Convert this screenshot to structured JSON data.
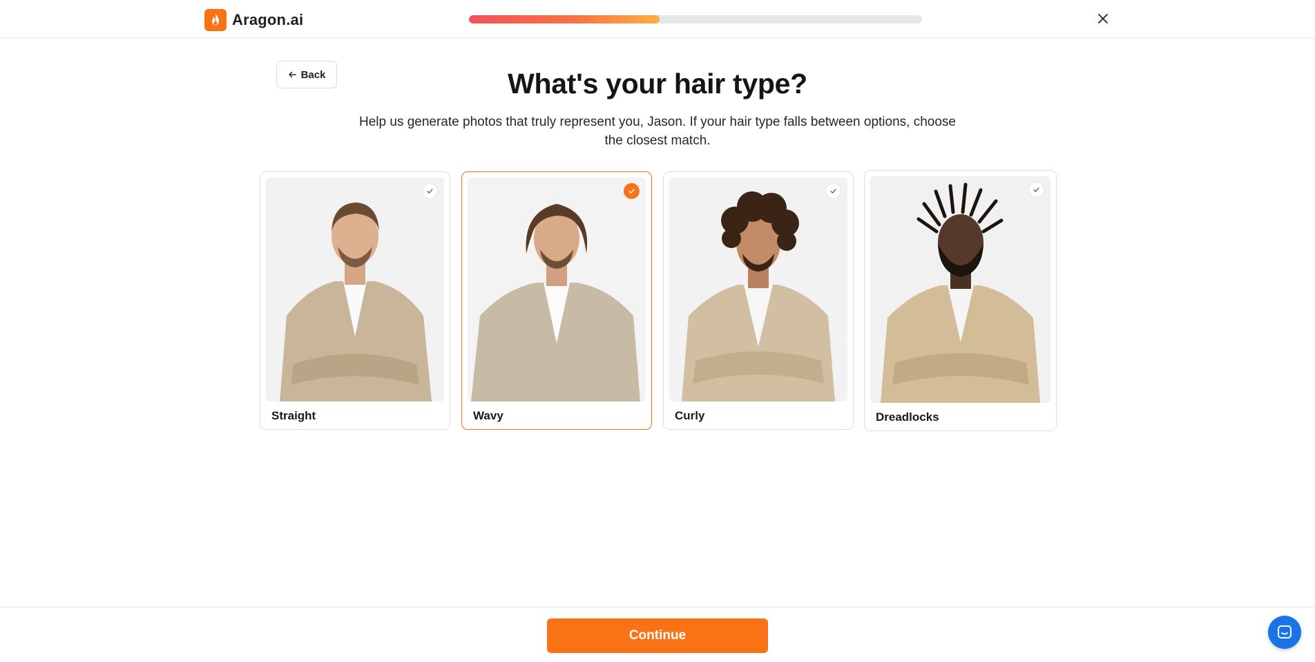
{
  "header": {
    "brand": "Aragon.ai",
    "progress_fraction": 0.42
  },
  "back_button": {
    "label": "Back"
  },
  "page": {
    "title": "What's your hair type?",
    "subtitle": "Help us generate photos that truly represent you, Jason. If your hair type falls between options, choose the closest match."
  },
  "options": [
    {
      "label": "Straight",
      "selected": false
    },
    {
      "label": "Wavy",
      "selected": true
    },
    {
      "label": "Curly",
      "selected": false
    },
    {
      "label": "Dreadlocks",
      "selected": false
    }
  ],
  "footer": {
    "continue_label": "Continue"
  },
  "colors": {
    "accent": "#f97316",
    "chat": "#1b73e8"
  }
}
